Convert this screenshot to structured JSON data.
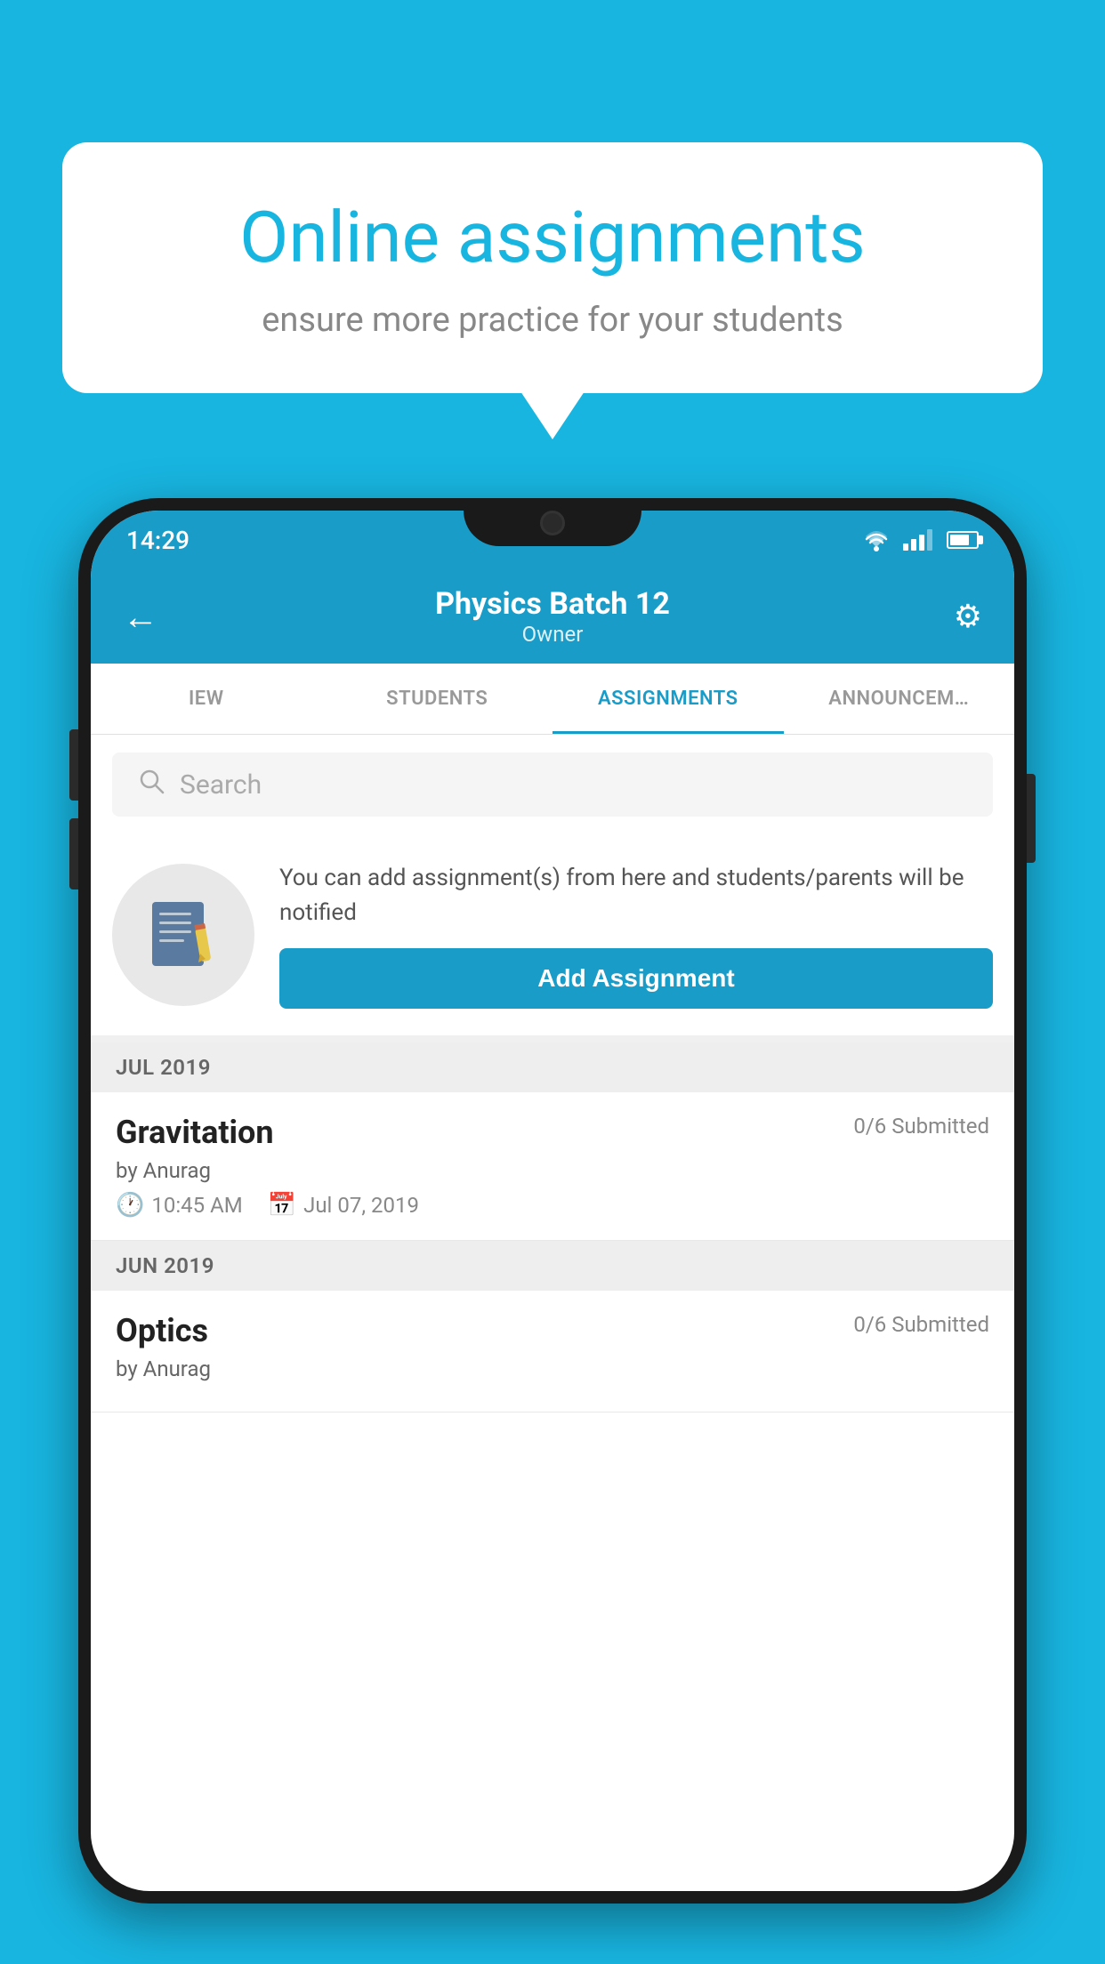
{
  "background_color": "#18b5e0",
  "promo": {
    "title": "Online assignments",
    "subtitle": "ensure more practice for your students"
  },
  "status_bar": {
    "time": "14:29",
    "wifi": "▼▲",
    "battery_label": "battery"
  },
  "header": {
    "title": "Physics Batch 12",
    "subtitle": "Owner",
    "back_label": "←",
    "settings_label": "⚙"
  },
  "tabs": [
    {
      "label": "IEW",
      "active": false
    },
    {
      "label": "STUDENTS",
      "active": false
    },
    {
      "label": "ASSIGNMENTS",
      "active": true
    },
    {
      "label": "ANNOUNCEM…",
      "active": false
    }
  ],
  "search": {
    "placeholder": "Search"
  },
  "add_assignment_section": {
    "description": "You can add assignment(s) from here and students/parents will be notified",
    "button_label": "Add Assignment"
  },
  "sections": [
    {
      "month": "JUL 2019",
      "assignments": [
        {
          "name": "Gravitation",
          "submitted": "0/6 Submitted",
          "by": "by Anurag",
          "time": "10:45 AM",
          "date": "Jul 07, 2019"
        }
      ]
    },
    {
      "month": "JUN 2019",
      "assignments": [
        {
          "name": "Optics",
          "submitted": "0/6 Submitted",
          "by": "by Anurag",
          "time": "",
          "date": ""
        }
      ]
    }
  ]
}
